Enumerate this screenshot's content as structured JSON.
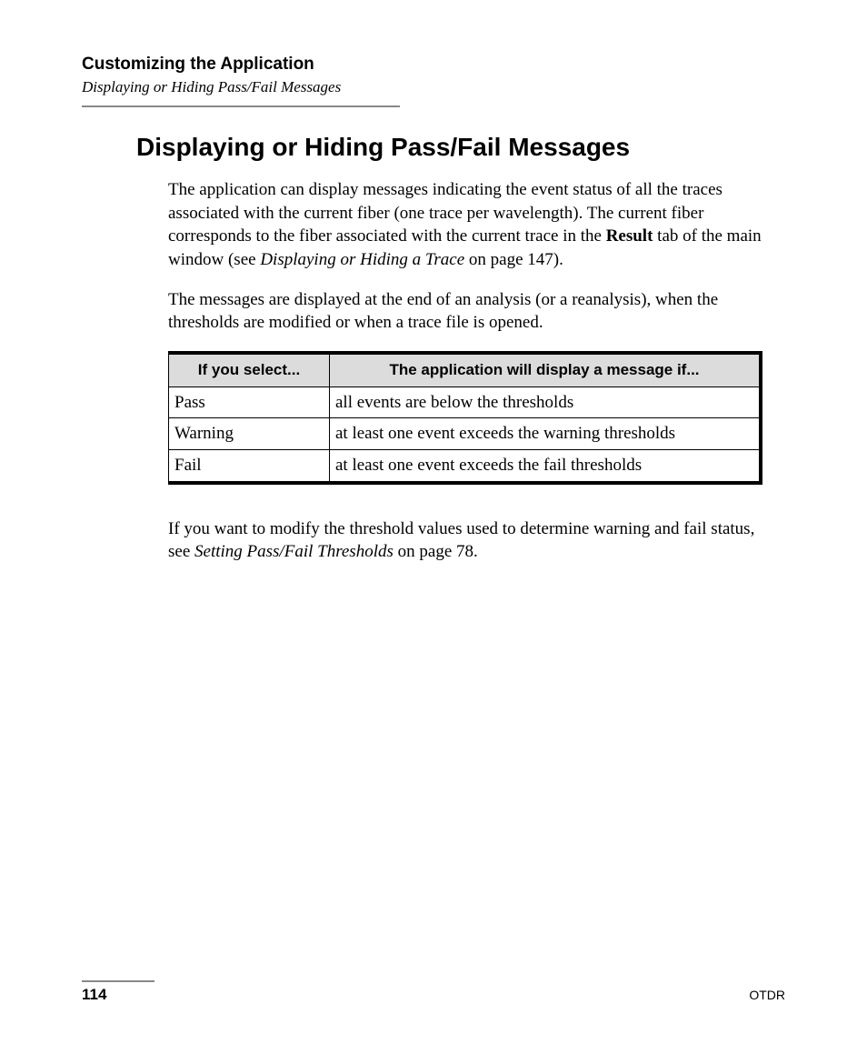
{
  "header": {
    "chapter": "Customizing the Application",
    "subsection": "Displaying or Hiding Pass/Fail Messages"
  },
  "section_title": "Displaying or Hiding Pass/Fail Messages",
  "paragraphs": {
    "p1a": "The application can display messages indicating the event status of all the traces associated with the current fiber (one trace per wavelength). The current fiber corresponds to the fiber associated with the current trace in the ",
    "p1_bold": "Result",
    "p1b": " tab of the main window (see ",
    "p1_ital": "Displaying or Hiding a Trace",
    "p1c": " on page 147).",
    "p2": "The messages are displayed at the end of an analysis (or a reanalysis), when the thresholds are modified or when a trace file is opened.",
    "p3a": "If you want to modify the threshold values used to determine warning and fail status, see ",
    "p3_ital": "Setting Pass/Fail Thresholds",
    "p3b": " on page 78."
  },
  "table": {
    "head": {
      "col1": "If you select...",
      "col2": "The application will display a message if..."
    },
    "rows": [
      {
        "select": "Pass",
        "msg": "all events are below the thresholds"
      },
      {
        "select": "Warning",
        "msg": "at least one event exceeds the warning thresholds"
      },
      {
        "select": "Fail",
        "msg": "at least one event exceeds the fail thresholds"
      }
    ]
  },
  "footer": {
    "page": "114",
    "doc": "OTDR"
  }
}
